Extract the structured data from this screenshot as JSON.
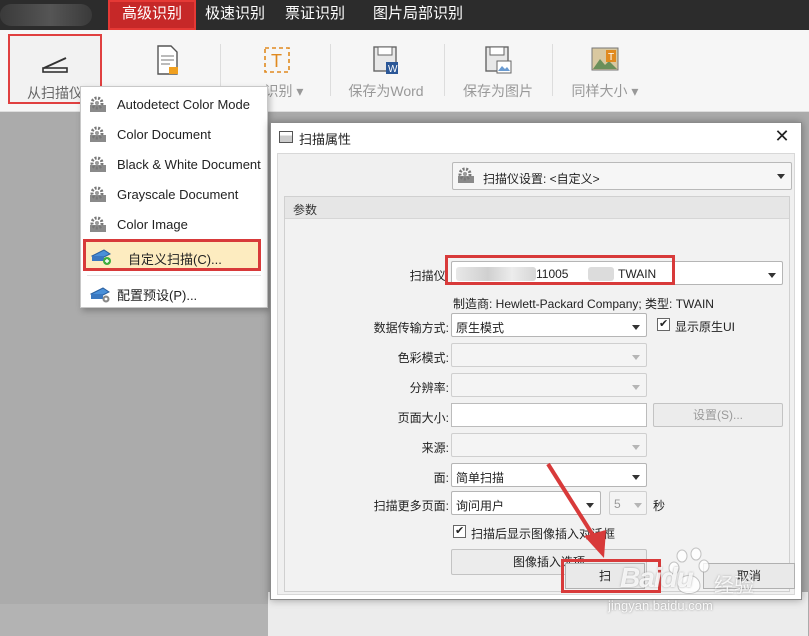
{
  "menu_bar": {
    "tabs": [
      "高级识别",
      "极速识别",
      "票证识别",
      "图片局部识别"
    ],
    "active_tab": "高级识别"
  },
  "ribbon": {
    "items": [
      {
        "label": "从扫描仪",
        "icon": "scanner-icon"
      },
      {
        "label": "",
        "icon": "document-icon"
      },
      {
        "label": "…识别 ▾",
        "icon": "text-recognition-icon"
      },
      {
        "label": "保存为Word",
        "icon": "save-word-icon"
      },
      {
        "label": "保存为图片",
        "icon": "save-image-icon"
      },
      {
        "label": "同样大小 ▾",
        "icon": "same-size-icon"
      }
    ]
  },
  "scan_menu": {
    "items": [
      {
        "label": "Autodetect Color Mode",
        "icon": "gear-icon"
      },
      {
        "label": "Color Document",
        "icon": "gear-icon"
      },
      {
        "label": "Black & White Document",
        "icon": "gear-icon"
      },
      {
        "label": "Grayscale Document",
        "icon": "gear-icon"
      },
      {
        "label": "Color Image",
        "icon": "gear-icon"
      },
      {
        "label": "自定义扫描(C)...",
        "icon": "scanner-add-icon",
        "highlighted": true
      },
      {
        "label": "配置预设(P)...",
        "icon": "scanner-config-icon"
      }
    ]
  },
  "dialog": {
    "title": "扫描属性",
    "close": "✕",
    "preset": "扫描仪设置: <自定义>",
    "group_title": "参数",
    "fields": {
      "scanner": {
        "label": "扫描仪:",
        "value": "11005",
        "value_suffix": "TWAIN"
      },
      "manufacturer_info": "制造商: Hewlett-Packard Company; 类型: TWAIN",
      "transfer_mode": {
        "label": "数据传输方式:",
        "value": "原生模式"
      },
      "show_native_ui": {
        "label": "显示原生UI",
        "checked": true
      },
      "color_mode": {
        "label": "色彩模式:",
        "value": ""
      },
      "resolution": {
        "label": "分辨率:",
        "value": ""
      },
      "page_size": {
        "label": "页面大小:",
        "value": ""
      },
      "page_size_button": "设置(S)...",
      "source": {
        "label": "来源:",
        "value": ""
      },
      "side": {
        "label": "面:",
        "value": "简单扫描"
      },
      "more_pages": {
        "label": "扫描更多页面:",
        "value": "询问用户",
        "seconds": "5",
        "seconds_unit": "秒"
      },
      "show_insert_dialog": {
        "label": "扫描后显示图像插入对话框",
        "checked": true
      },
      "insert_options_button": "图像插入选项"
    },
    "footer_buttons": [
      "扫",
      "取消"
    ]
  },
  "colors": {
    "accent_red": "#d83a3a",
    "menu_bar_bg": "#2c2c2c",
    "active_tab_bg": "#c62828",
    "highlight_bg": "#fdecc0"
  },
  "watermark": {
    "brand": "Baidu",
    "suffix": "经验",
    "url": "jingyan.baidu.com"
  }
}
